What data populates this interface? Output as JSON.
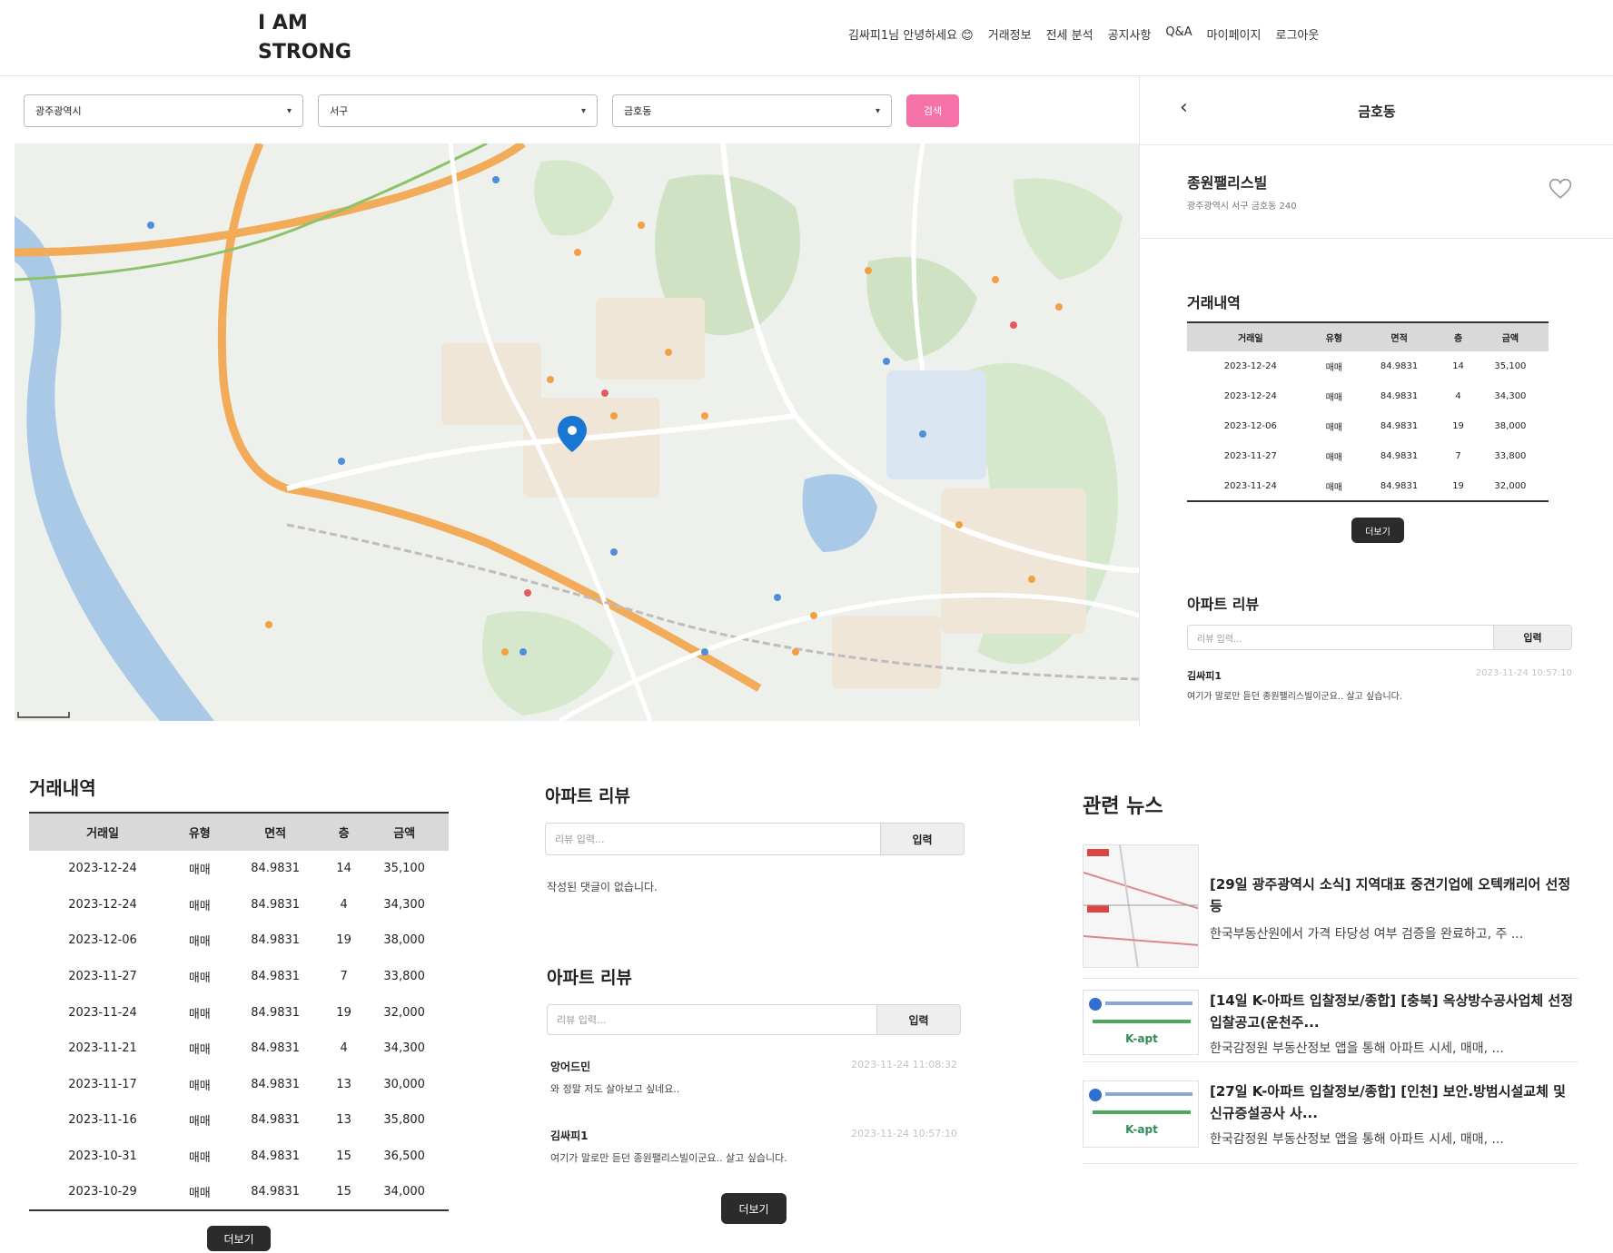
{
  "header": {
    "logo_line1": "I AM",
    "logo_line2": "STRONG",
    "greeting": "김싸피1님 안녕하세요 😊",
    "nav": [
      "거래정보",
      "전세 분석",
      "공지사항",
      "Q&A",
      "마이페이지",
      "로그아웃"
    ]
  },
  "filters": {
    "city": "광주광역시",
    "district": "서구",
    "dong": "금호동",
    "search_label": "검색"
  },
  "panel": {
    "title": "금호동",
    "apt_name": "종원팰리스빌",
    "apt_address": "광주광역시 서구 금호동 240",
    "trade_heading": "거래내역",
    "more_label": "더보기",
    "review_heading": "아파트 리뷰",
    "review_placeholder": "리뷰 입력...",
    "review_submit": "입력",
    "comments": [
      {
        "author": "김싸피1",
        "time": "2023-11-24 10:57:10",
        "text": "여기가 말로만 듣던 종원팰리스빌이군요.. 살고 싶습니다."
      }
    ]
  },
  "trade_columns": [
    "거래일",
    "유형",
    "면적",
    "층",
    "금액"
  ],
  "trades": [
    {
      "date": "2023-12-24",
      "type": "매매",
      "area": "84.9831",
      "floor": "14",
      "price": "35,100"
    },
    {
      "date": "2023-12-24",
      "type": "매매",
      "area": "84.9831",
      "floor": "4",
      "price": "34,300"
    },
    {
      "date": "2023-12-06",
      "type": "매매",
      "area": "84.9831",
      "floor": "19",
      "price": "38,000"
    },
    {
      "date": "2023-11-27",
      "type": "매매",
      "area": "84.9831",
      "floor": "7",
      "price": "33,800"
    },
    {
      "date": "2023-11-24",
      "type": "매매",
      "area": "84.9831",
      "floor": "19",
      "price": "32,000"
    },
    {
      "date": "2023-11-21",
      "type": "매매",
      "area": "84.9831",
      "floor": "4",
      "price": "34,300"
    },
    {
      "date": "2023-11-17",
      "type": "매매",
      "area": "84.9831",
      "floor": "13",
      "price": "30,000"
    },
    {
      "date": "2023-11-16",
      "type": "매매",
      "area": "84.9831",
      "floor": "13",
      "price": "35,800"
    },
    {
      "date": "2023-10-31",
      "type": "매매",
      "area": "84.9831",
      "floor": "15",
      "price": "36,500"
    },
    {
      "date": "2023-10-29",
      "type": "매매",
      "area": "84.9831",
      "floor": "15",
      "price": "34,000"
    }
  ],
  "bottom": {
    "trade_heading": "거래내역",
    "more_label": "더보기",
    "review1": {
      "heading": "아파트 리뷰",
      "placeholder": "리뷰 입력...",
      "submit": "입력",
      "empty_text": "작성된 댓글이 없습니다."
    },
    "review2": {
      "heading": "아파트 리뷰",
      "placeholder": "리뷰 입력...",
      "submit": "입력",
      "more_label": "더보기",
      "comments": [
        {
          "author": "앙어드민",
          "time": "2023-11-24 11:08:32",
          "text": "와 정말 저도 살아보고 싶네요.."
        },
        {
          "author": "김싸피1",
          "time": "2023-11-24 10:57:10",
          "text": "여기가 말로만 듣던 종원팰리스빌이군요.. 살고 싶습니다."
        }
      ]
    },
    "news": {
      "heading": "관련 뉴스",
      "items": [
        {
          "title": "[29일 광주광역시 소식] 지역대표 중견기업에 오텍캐리어 선정 등",
          "desc": "한국부동산원에서 가격 타당성 여부 검증을 완료하고, 주 ..."
        },
        {
          "title": "[14일 K-아파트 입찰정보/종합] [충북] 옥상방수공사업체 선정입찰공고(운천주...",
          "desc": "한국감정원 부동산정보 앱을 통해 아파트 시세, 매매, ...",
          "thumb_label": "K-apt"
        },
        {
          "title": "[27일 K-아파트 입찰정보/종합] [인천] 보안.방범시설교체 및 신규증설공사 사...",
          "desc": "한국감정원 부동산정보 앱을 통해 아파트 시세, 매매, ...",
          "thumb_label": "K-apt"
        }
      ]
    }
  },
  "colors": {
    "accent_pink": "#f472a8",
    "dark_button": "#2b2b2b",
    "table_header": "#d9d9d9",
    "map_water": "#a9c9e6",
    "map_green": "#cfe3c4",
    "map_highway": "#f2ab58",
    "map_marker": "#1976d2"
  }
}
